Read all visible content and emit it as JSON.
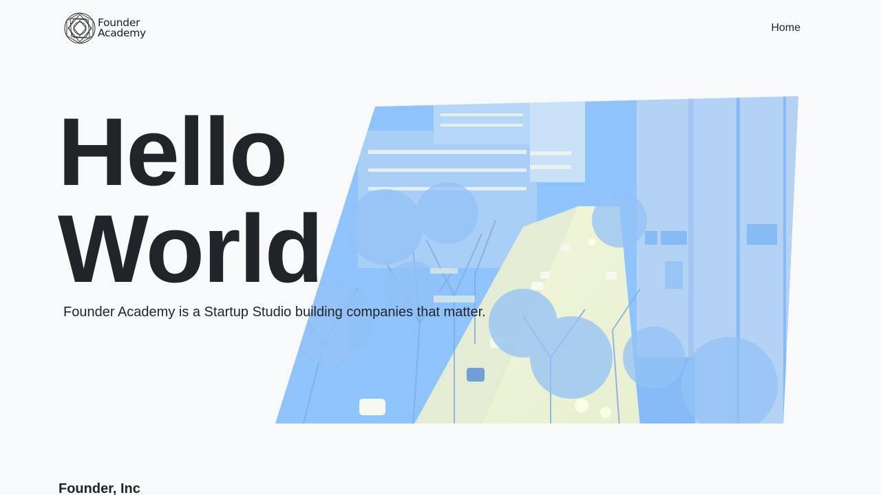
{
  "header": {
    "logo_line1": "Founder",
    "logo_line2": "Academy",
    "nav_home": "Home"
  },
  "hero": {
    "headline_line1": "Hello",
    "headline_line2": "World",
    "lead": "Founder Academy is a Startup Studio building companies that matter.",
    "image_description_icon": "city-street-photo",
    "image_tint": "#8ec3fb"
  },
  "footer": {
    "title": "Founder, Inc"
  }
}
